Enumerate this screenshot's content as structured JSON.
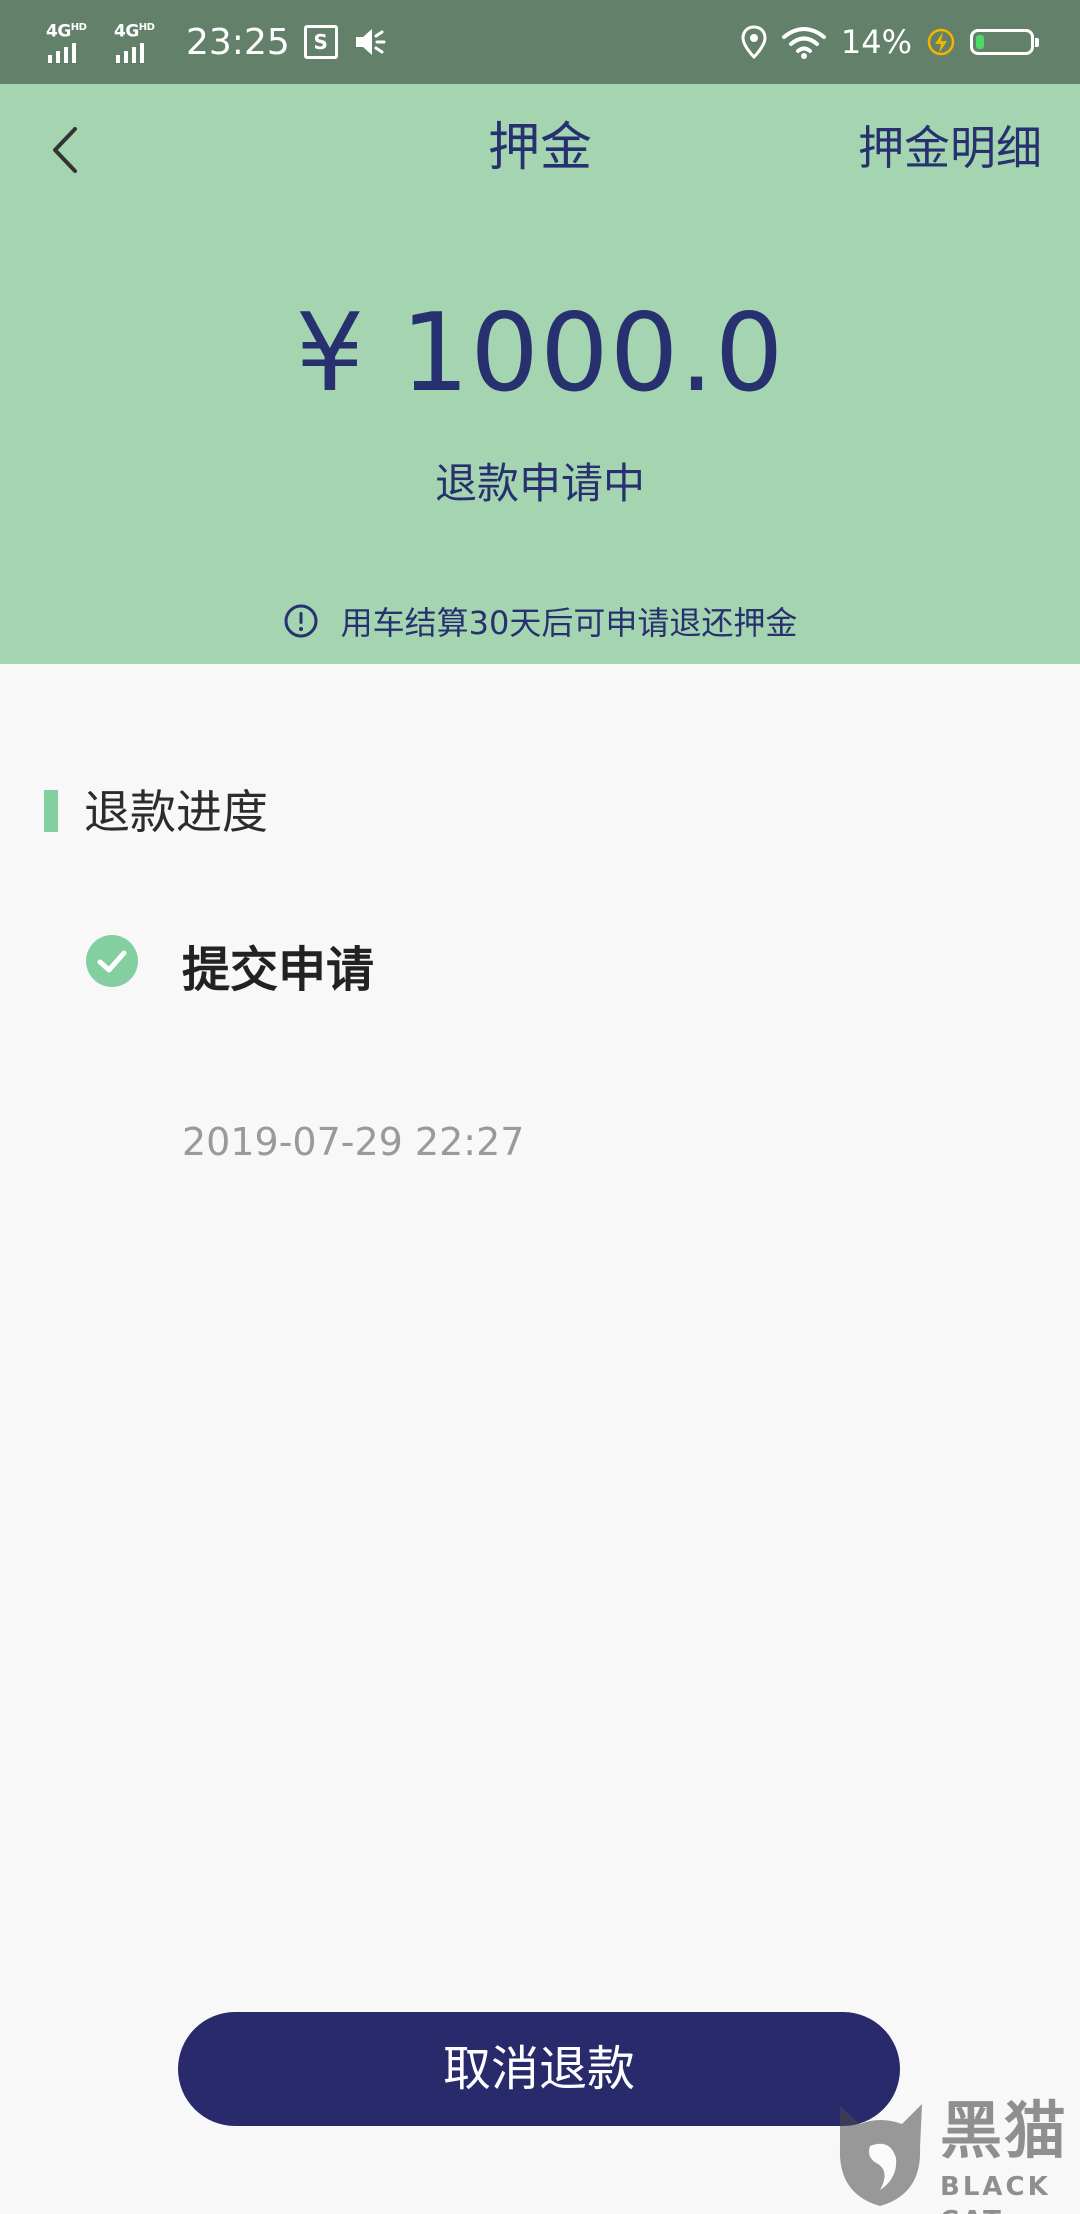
{
  "status_bar": {
    "network_1": "4G",
    "network_2": "4G",
    "network_tag": "HD",
    "time": "23:25",
    "battery": "14%"
  },
  "header": {
    "title": "押金",
    "detail_link": "押金明细",
    "amount": "¥ 1000.0",
    "status": "退款申请中",
    "notice": "用车结算30天后可申请退还押金"
  },
  "progress": {
    "section_title": "退款进度",
    "steps": [
      {
        "title": "提交申请",
        "time": "2019-07-29 22:27",
        "done": true
      }
    ]
  },
  "actions": {
    "cancel_refund": "取消退款"
  },
  "watermark": {
    "cn": "黑猫",
    "en": "BLACK CAT"
  },
  "colors": {
    "header_bg": "#a5d5b0",
    "status_bar_bg": "#63816a",
    "primary_text": "#283170",
    "button_bg": "#282a6c",
    "accent_green": "#83cfa0"
  }
}
